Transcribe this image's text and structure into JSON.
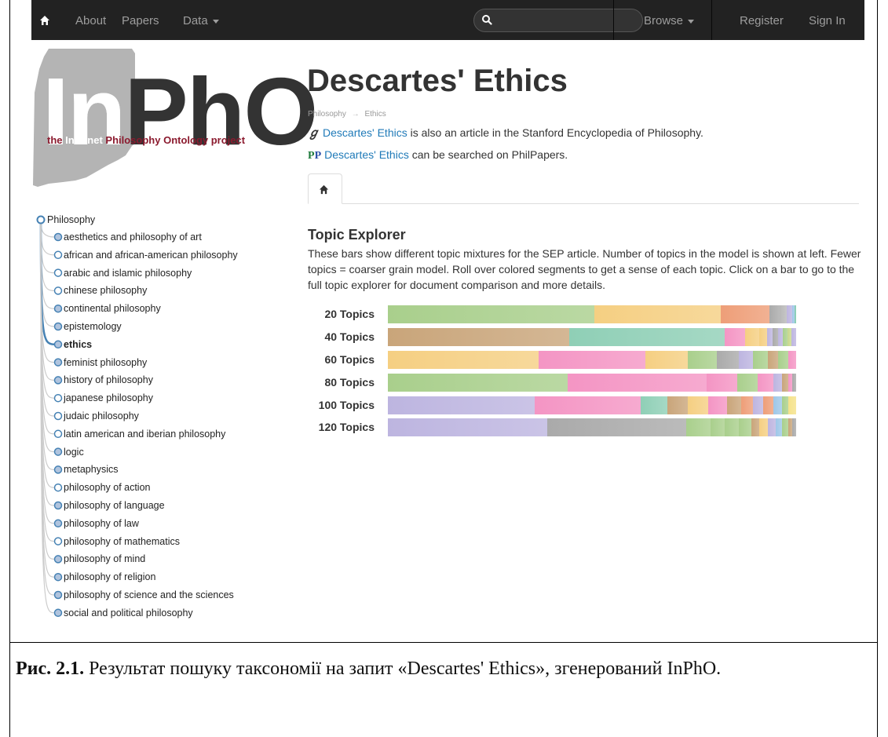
{
  "navbar": {
    "home_icon": "home-icon",
    "about": "About",
    "papers": "Papers",
    "data": "Data",
    "search_placeholder": "",
    "browse": "Browse",
    "register": "Register",
    "signin": "Sign In"
  },
  "logo": {
    "main_text_part1": "In",
    "main_text_part2": "PhO",
    "sub_part1": "the ",
    "sub_part2": "Internet",
    "sub_part3": " Philosophy Ontology project"
  },
  "page": {
    "title": "Descartes' Ethics",
    "breadcrumb": {
      "root": "Philosophy",
      "arrow": "→",
      "leaf": "Ethics"
    },
    "sep_link": "Descartes' Ethics",
    "sep_text": " is also an article in the Stanford Encyclopedia of Philosophy.",
    "philpapers_link": "Descartes' Ethics",
    "philpapers_text": " can be searched on PhilPapers.",
    "sep_icon": "sep-icon",
    "philpapers_icon": "philpapers-icon",
    "tab_icon": "home-icon"
  },
  "topic_explorer": {
    "title": "Topic Explorer",
    "description": "These bars show different topic mixtures for the SEP article. Number of topics in the model is shown at left. Fewer topics = coarser grain model. Roll over colored segments to get a sense of each topic. Click on a bar to go to the full topic explorer for document comparison and more details.",
    "rows": [
      {
        "label": "20 Topics",
        "segments": [
          {
            "share": 50.5,
            "color": "#a9cf8c"
          },
          {
            "share": 31,
            "color": "#f5cf82"
          },
          {
            "share": 12,
            "color": "#ee9e78"
          },
          {
            "share": 2.4,
            "color": "#aaaaaa"
          },
          {
            "share": 1.8,
            "color": "#b8b8b8"
          },
          {
            "share": 1.3,
            "color": "#bdb5e0"
          },
          {
            "share": 0.6,
            "color": "#9ec7e8"
          },
          {
            "share": 0.4,
            "color": "#80c9b0"
          }
        ]
      },
      {
        "label": "40 Topics",
        "segments": [
          {
            "share": 44.5,
            "color": "#c9a57a"
          },
          {
            "share": 38,
            "color": "#8fcfb6"
          },
          {
            "share": 5,
            "color": "#f495c4"
          },
          {
            "share": 3.5,
            "color": "#f5cf82"
          },
          {
            "share": 1.9,
            "color": "#f5cf82"
          },
          {
            "share": 1.3,
            "color": "#bdb5e0"
          },
          {
            "share": 1.3,
            "color": "#aaaaaa"
          },
          {
            "share": 1.2,
            "color": "#bdb5e0"
          },
          {
            "share": 1.2,
            "color": "#a9cf8c"
          },
          {
            "share": 1,
            "color": "#c8d88c"
          },
          {
            "share": 1.1,
            "color": "#bdb5e0"
          }
        ]
      },
      {
        "label": "60 Topics",
        "segments": [
          {
            "share": 37,
            "color": "#f5cf82"
          },
          {
            "share": 26,
            "color": "#f495c4"
          },
          {
            "share": 10.5,
            "color": "#f5cf82"
          },
          {
            "share": 7,
            "color": "#a9cf8c"
          },
          {
            "share": 5.5,
            "color": "#aaaaaa"
          },
          {
            "share": 3.5,
            "color": "#bdb5e0"
          },
          {
            "share": 3.5,
            "color": "#a9cf8c"
          },
          {
            "share": 2.5,
            "color": "#c9a57a"
          },
          {
            "share": 2.5,
            "color": "#a9cf8c"
          },
          {
            "share": 2,
            "color": "#f495c4"
          }
        ]
      },
      {
        "label": "80 Topics",
        "segments": [
          {
            "share": 44,
            "color": "#a9cf8c"
          },
          {
            "share": 34,
            "color": "#f495c4"
          },
          {
            "share": 7.5,
            "color": "#f495c4"
          },
          {
            "share": 5,
            "color": "#a9cf8c"
          },
          {
            "share": 4,
            "color": "#f495c4"
          },
          {
            "share": 2,
            "color": "#bdb5e0"
          },
          {
            "share": 1.5,
            "color": "#c9a57a"
          },
          {
            "share": 1,
            "color": "#f495c4"
          },
          {
            "share": 1,
            "color": "#aaaaaa"
          }
        ]
      },
      {
        "label": "100 Topics",
        "segments": [
          {
            "share": 36,
            "color": "#bdb5e0"
          },
          {
            "share": 26,
            "color": "#f495c4"
          },
          {
            "share": 6.5,
            "color": "#8fcfb6"
          },
          {
            "share": 5,
            "color": "#c9a57a"
          },
          {
            "share": 5,
            "color": "#f5cf82"
          },
          {
            "share": 4.5,
            "color": "#f495c4"
          },
          {
            "share": 3.5,
            "color": "#c9a57a"
          },
          {
            "share": 3,
            "color": "#ee9e78"
          },
          {
            "share": 2.5,
            "color": "#bdb5e0"
          },
          {
            "share": 2.5,
            "color": "#ee9e78"
          },
          {
            "share": 2,
            "color": "#9ec7e8"
          },
          {
            "share": 1.5,
            "color": "#a9cf8c"
          },
          {
            "share": 2,
            "color": "#f5e28a"
          }
        ]
      },
      {
        "label": "120 Topics",
        "segments": [
          {
            "share": 39,
            "color": "#bdb5e0"
          },
          {
            "share": 34,
            "color": "#aaaaaa"
          },
          {
            "share": 6,
            "color": "#a9cf8c"
          },
          {
            "share": 3.5,
            "color": "#a9cf8c"
          },
          {
            "share": 3.5,
            "color": "#a9cf8c"
          },
          {
            "share": 3,
            "color": "#a9cf8c"
          },
          {
            "share": 2,
            "color": "#c9a57a"
          },
          {
            "share": 2,
            "color": "#f5cf82"
          },
          {
            "share": 2,
            "color": "#bdb5e0"
          },
          {
            "share": 1.5,
            "color": "#9ec7e8"
          },
          {
            "share": 1.5,
            "color": "#a9cf8c"
          },
          {
            "share": 1,
            "color": "#c9a57a"
          },
          {
            "share": 1,
            "color": "#aaaaaa"
          }
        ]
      }
    ]
  },
  "tree": {
    "root": "Philosophy",
    "children": [
      {
        "label": "aesthetics and philosophy of art",
        "filled": true,
        "bold": false
      },
      {
        "label": "african and african-american philosophy",
        "filled": false,
        "bold": false
      },
      {
        "label": "arabic and islamic philosophy",
        "filled": false,
        "bold": false
      },
      {
        "label": "chinese philosophy",
        "filled": false,
        "bold": false
      },
      {
        "label": "continental philosophy",
        "filled": true,
        "bold": false
      },
      {
        "label": "epistemology",
        "filled": true,
        "bold": false
      },
      {
        "label": "ethics",
        "filled": true,
        "bold": true
      },
      {
        "label": "feminist philosophy",
        "filled": true,
        "bold": false
      },
      {
        "label": "history of philosophy",
        "filled": true,
        "bold": false
      },
      {
        "label": "japanese philosophy",
        "filled": false,
        "bold": false
      },
      {
        "label": "judaic philosophy",
        "filled": false,
        "bold": false
      },
      {
        "label": "latin american and iberian philosophy",
        "filled": false,
        "bold": false
      },
      {
        "label": "logic",
        "filled": true,
        "bold": false
      },
      {
        "label": "metaphysics",
        "filled": true,
        "bold": false
      },
      {
        "label": "philosophy of action",
        "filled": false,
        "bold": false
      },
      {
        "label": "philosophy of language",
        "filled": true,
        "bold": false
      },
      {
        "label": "philosophy of law",
        "filled": true,
        "bold": false
      },
      {
        "label": "philosophy of mathematics",
        "filled": false,
        "bold": false
      },
      {
        "label": "philosophy of mind",
        "filled": true,
        "bold": false
      },
      {
        "label": "philosophy of religion",
        "filled": true,
        "bold": false
      },
      {
        "label": "philosophy of science and the sciences",
        "filled": true,
        "bold": false
      },
      {
        "label": "social and political philosophy",
        "filled": true,
        "bold": false
      }
    ]
  },
  "caption": {
    "label": "Рис. 2.1.",
    "text": " Результат пошуку таксономії на запит «Descartes' Ethics», згенерований InPhO."
  }
}
